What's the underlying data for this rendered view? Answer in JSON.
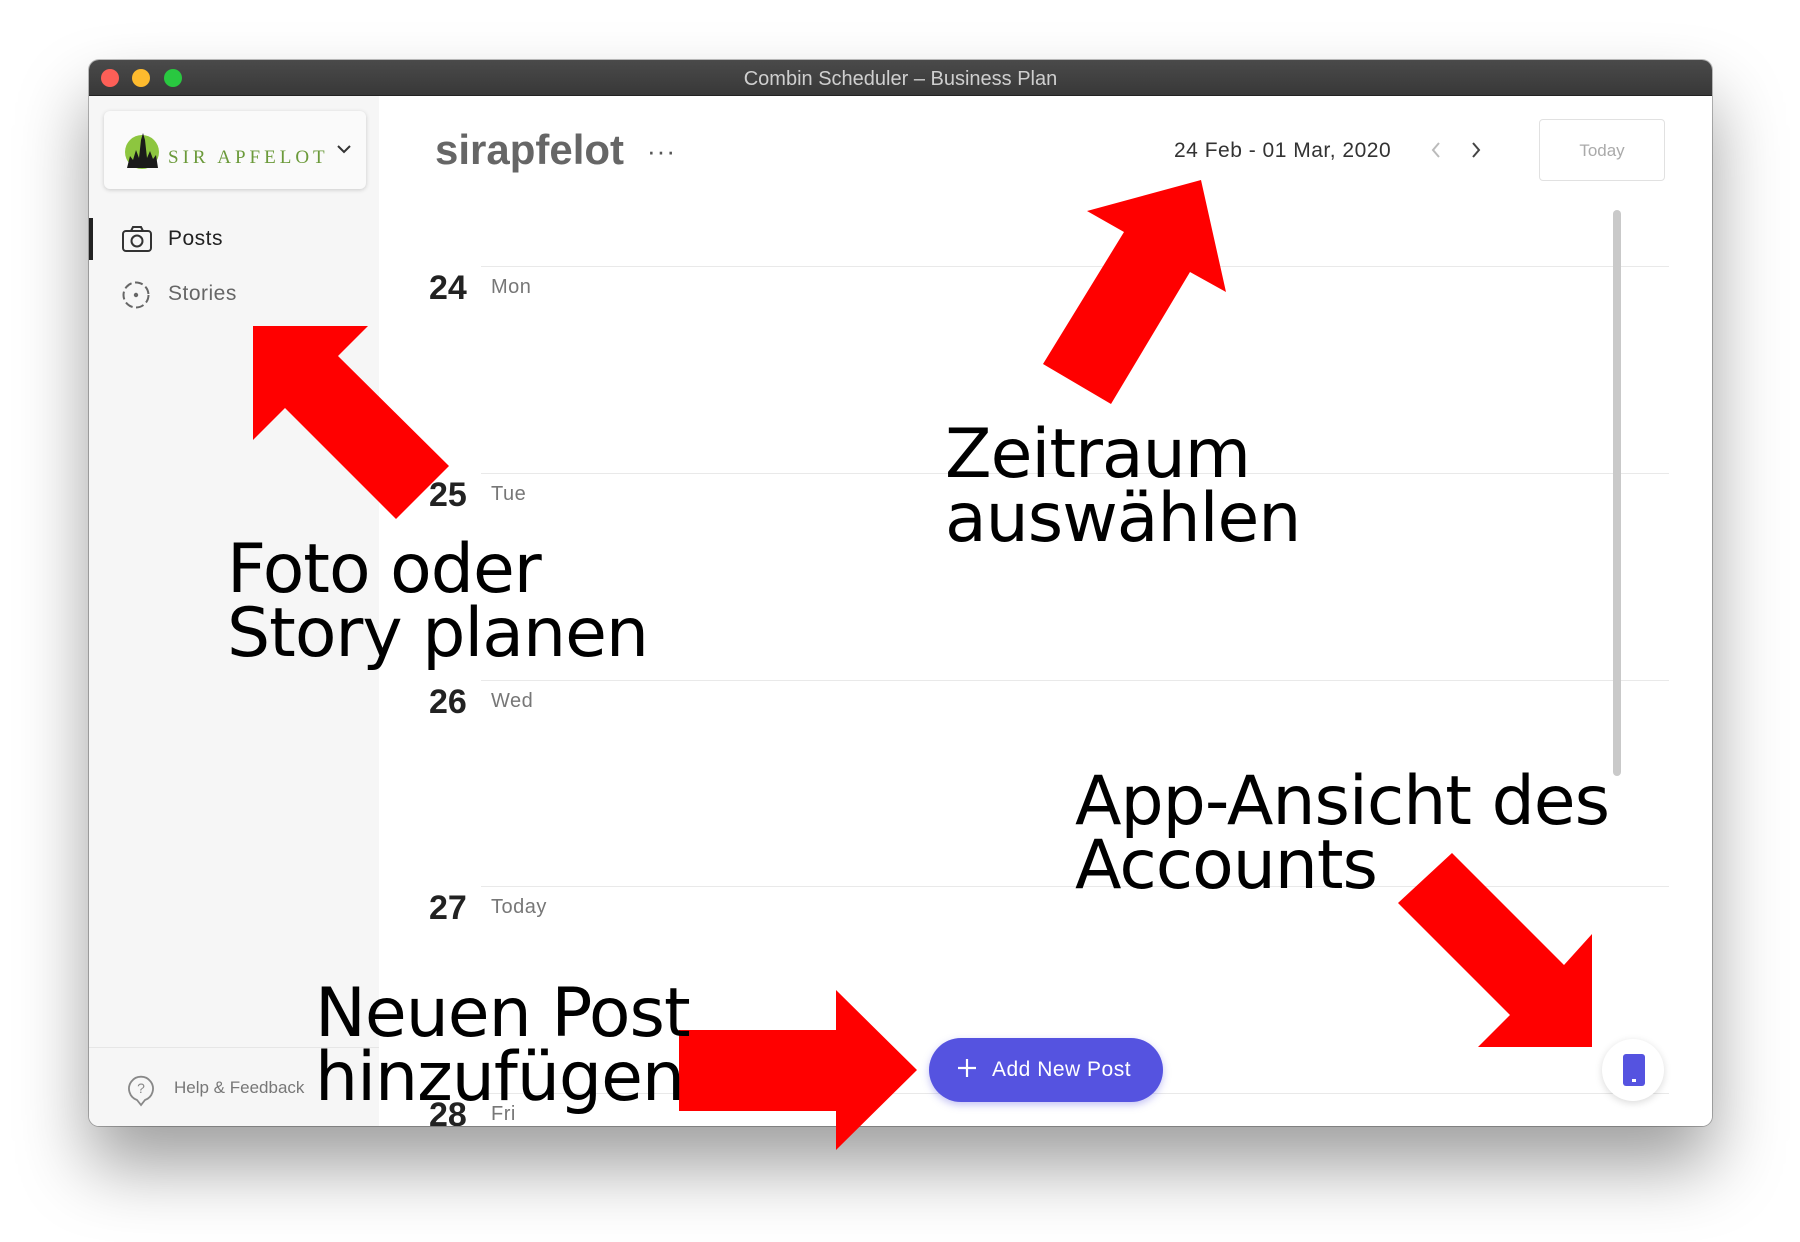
{
  "window": {
    "title": "Combin Scheduler  – Business Plan"
  },
  "sidebar": {
    "account_name": "SIR APFELOT",
    "items": [
      {
        "label": "Posts",
        "icon": "camera-icon",
        "active": true
      },
      {
        "label": "Stories",
        "icon": "stories-icon",
        "active": false
      }
    ],
    "help_label": "Help & Feedback"
  },
  "header": {
    "account_title": "sirapfelot",
    "more_label": "···",
    "date_range": "24 Feb - 01 Mar, 2020",
    "today_label": "Today"
  },
  "calendar": {
    "days": [
      {
        "num": "24",
        "name": "Mon"
      },
      {
        "num": "25",
        "name": "Tue"
      },
      {
        "num": "26",
        "name": "Wed"
      },
      {
        "num": "27",
        "name": "Today"
      },
      {
        "num": "28",
        "name": "Fri"
      }
    ]
  },
  "actions": {
    "add_post_label": "Add New Post"
  },
  "annotations": {
    "plan": "Foto oder\nStory planen",
    "range": "Zeitraum\nauswählen",
    "app_view": "App-Ansicht des\nAccounts",
    "new_post": "Neuen Post\nhinzufügen"
  },
  "colors": {
    "accent": "#5553e0",
    "annotation_arrow": "#ff0000"
  }
}
